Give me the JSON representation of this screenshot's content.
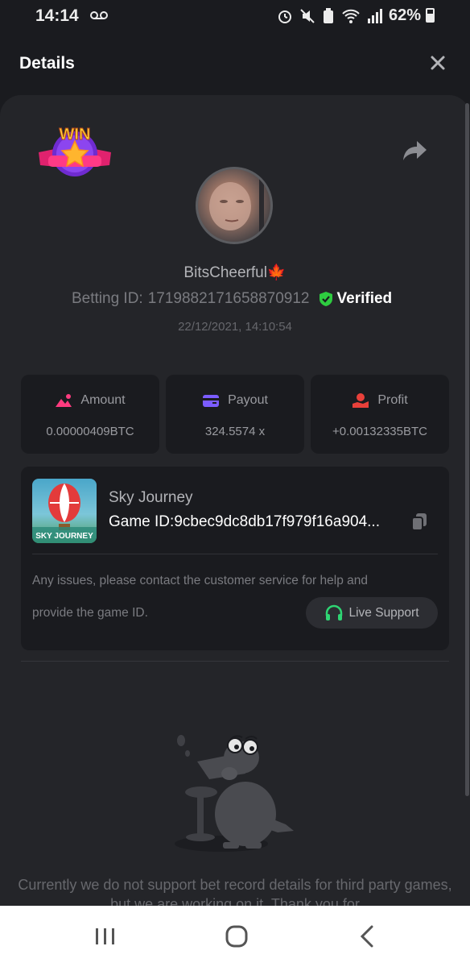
{
  "status_bar": {
    "time": "14:14",
    "voicemail": "oo",
    "battery": "62%"
  },
  "header": {
    "title": "Details"
  },
  "profile": {
    "username": "BitsCheerful🍁",
    "betting_label": "Betting ID:",
    "betting_id": "1719882171658870912",
    "verified": "Verified",
    "timestamp": "22/12/2021, 14:10:54",
    "badge": "WIN"
  },
  "stats": {
    "amount": {
      "label": "Amount",
      "value": "0.00000409BTC"
    },
    "payout": {
      "label": "Payout",
      "value": "324.5574 x"
    },
    "profit": {
      "label": "Profit",
      "value": "+0.00132335BTC"
    }
  },
  "game": {
    "name": "Sky Journey",
    "id_label": "Game ID:",
    "id_value": "9cbec9dc8db17f979f16a904...",
    "thumb_label": "SKY JOURNEY",
    "help_line1": "Any issues, please contact the customer service for help and",
    "help_line2": "provide the game ID.",
    "live_support": "Live Support"
  },
  "notice": {
    "text": "Currently we do not support bet record details for third party games, but we are working on it. Thank you for"
  },
  "colors": {
    "background": "#1a1b1f",
    "panel": "#242529",
    "verified_green": "#2ecc40",
    "accent_purple": "#7b5cff",
    "amount_pink": "#ff3b7f",
    "profit_red": "#e8403a",
    "support_green": "#2ed573"
  },
  "icons": {
    "close": "close-icon",
    "share": "share-icon",
    "copy": "copy-icon",
    "headset": "headset-icon"
  }
}
